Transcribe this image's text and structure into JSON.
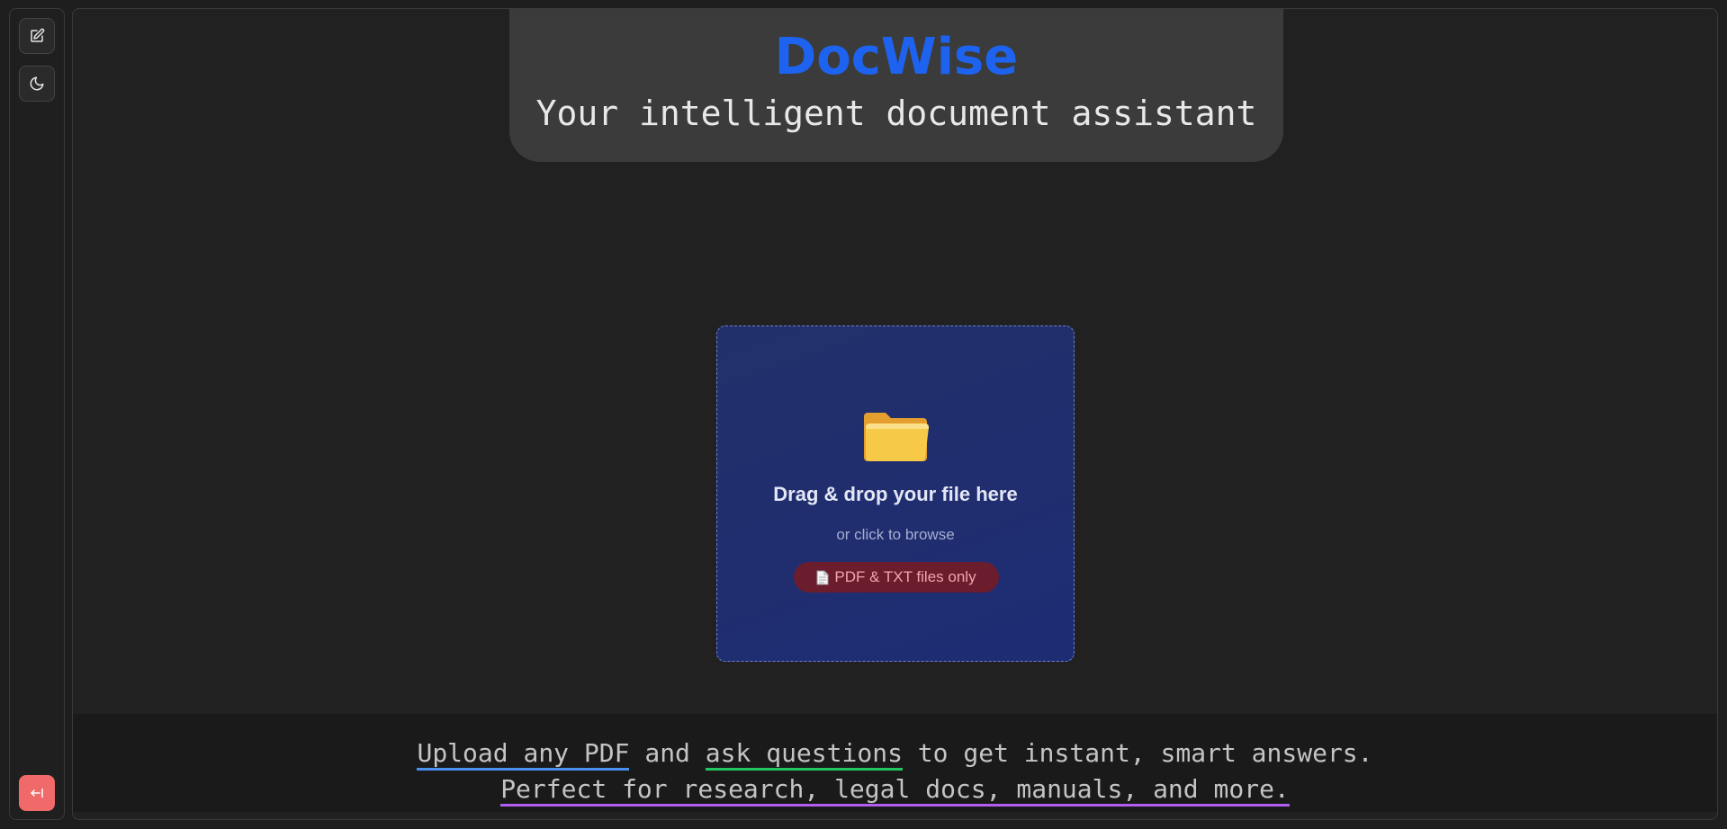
{
  "app": {
    "title": "DocWise",
    "subtitle": "Your intelligent document assistant"
  },
  "sidebar": {
    "buttons": [
      {
        "icon": "edit-icon"
      },
      {
        "icon": "moon-icon"
      },
      {
        "icon": "exit-icon"
      }
    ]
  },
  "upload": {
    "icon": "folder-icon",
    "title": "Drag & drop your file here",
    "subtitle": "or click to browse",
    "badge": "PDF & TXT files only"
  },
  "footer": {
    "line1": {
      "link1": "Upload any PDF",
      "text1": " and ",
      "link2": "ask questions",
      "text2": " to get instant, smart answers."
    },
    "line2": {
      "link": "Perfect for research, legal docs, manuals, and more."
    }
  },
  "colors": {
    "accent": "#1e63f0",
    "dropzone": "#1e2c74",
    "badge": "#6b1d2e",
    "exit": "#f06a6a"
  }
}
